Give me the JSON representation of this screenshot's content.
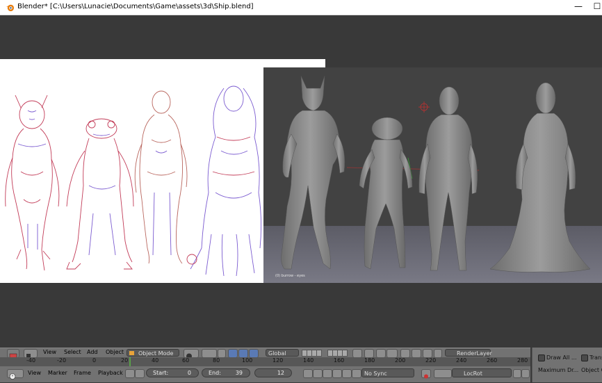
{
  "window": {
    "title": "Blender* [C:\\Users\\Lunacie\\Documents\\Game\\assets\\3d\\Ship.blend]",
    "minimize_glyph": "—",
    "maximize_glyph": "☐"
  },
  "viewport": {
    "object_label": "(0) burrow - eyes"
  },
  "header_3d": {
    "menu": [
      "View",
      "Select",
      "Add",
      "Object"
    ],
    "mode": "Object Mode",
    "orientation": "Global",
    "render_layer": "RenderLayer"
  },
  "timeline": {
    "ruler_ticks": [
      "-40",
      "-20",
      "0",
      "20",
      "40",
      "60",
      "80",
      "100",
      "120",
      "140",
      "160",
      "180",
      "200",
      "220",
      "240",
      "260",
      "280"
    ],
    "menu": [
      "View",
      "Marker",
      "Frame",
      "Playback"
    ],
    "start_label": "Start:",
    "start_value": "0",
    "end_label": "End:",
    "end_value": "39",
    "current_frame": "12",
    "sync": "No Sync",
    "keying_set": "LocRot"
  },
  "side_panel": {
    "draw_all": "Draw All ...",
    "trans": "Trans",
    "maximum_draw": "Maximum Dr...",
    "object_c": "Object C"
  },
  "colors": {
    "viewport_bg": "#393939",
    "header_bg": "#727272",
    "sketch_red": "#d33a4a",
    "sketch_purple": "#6a55c9"
  }
}
